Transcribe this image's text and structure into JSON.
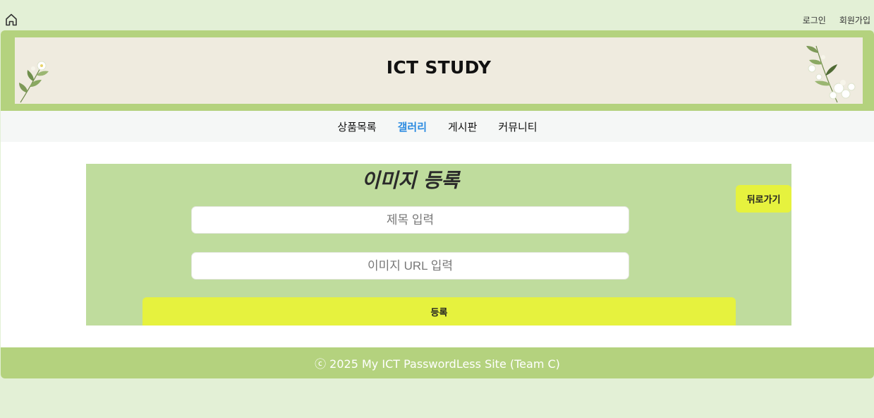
{
  "top_nav": {
    "login": "로그인",
    "signup": "회원가입"
  },
  "banner": {
    "title": "ICT STUDY"
  },
  "nav": {
    "items": [
      "상품목록",
      "갤러리",
      "게시판",
      "커뮤니티"
    ],
    "active": "갤러리"
  },
  "form": {
    "heading": "이미지 등록",
    "back_label": "뒤로가기",
    "title_placeholder": "제목 입력",
    "url_placeholder": "이미지 URL 입력",
    "submit_label": "등록"
  },
  "footer": {
    "text": "ⓒ 2025 My ICT PasswordLess Site (Team C)"
  },
  "colors": {
    "page_bg": "#e3f0d6",
    "band_green": "#b4d27e",
    "banner_bg": "#efebdf",
    "panel_green": "#bfdc9d",
    "button_yellow": "#e6f23e",
    "active_nav": "#2a8ae0"
  },
  "icons": [
    "home-icon",
    "flower-decoration-left",
    "flower-decoration-right"
  ]
}
